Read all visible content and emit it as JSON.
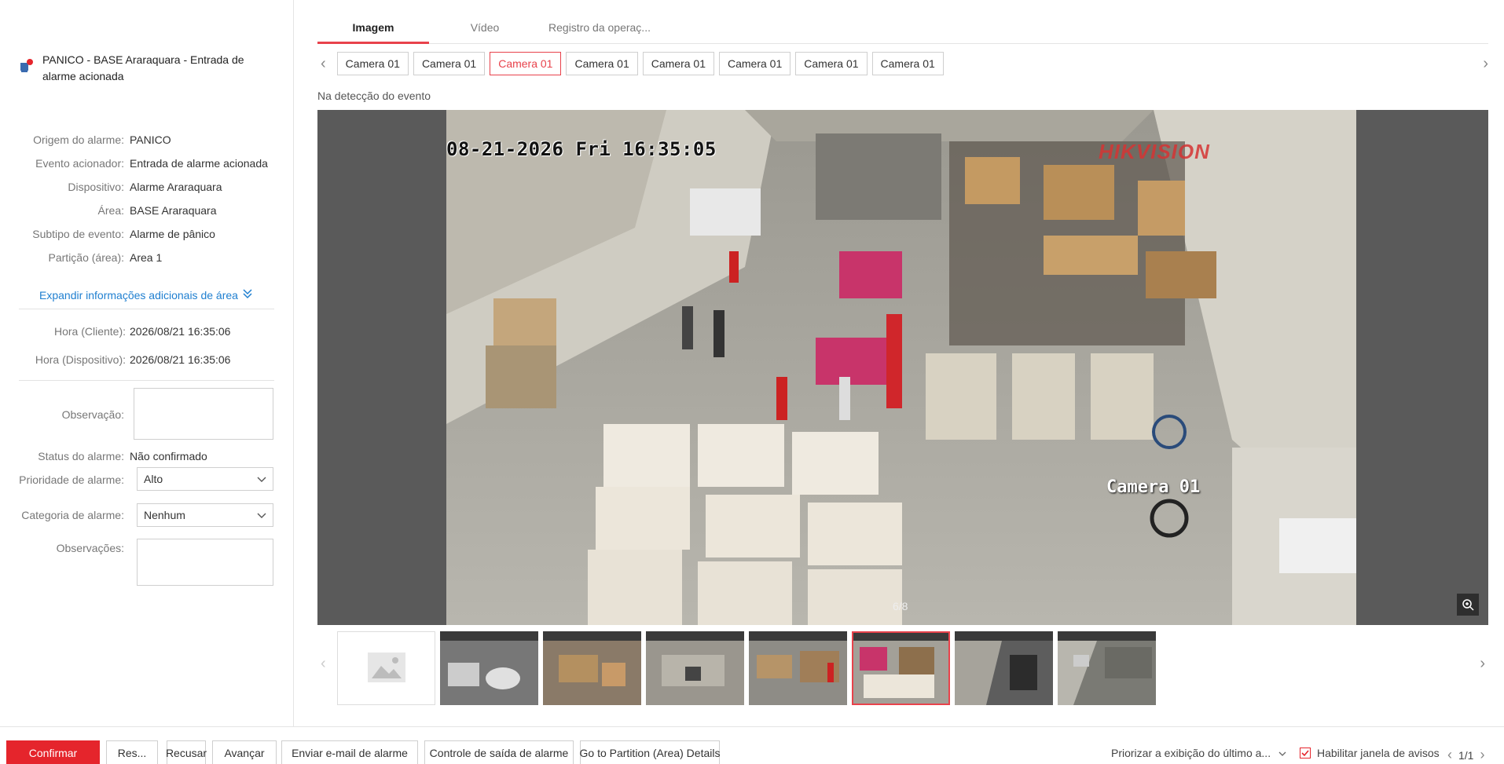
{
  "alarm": {
    "title": "PANICO - BASE Araraquara - Entrada de alarme acionada"
  },
  "details": [
    {
      "label": "Origem do alarme:",
      "value": "PANICO"
    },
    {
      "label": "Evento acionador:",
      "value": "Entrada de alarme acionada"
    },
    {
      "label": "Dispositivo:",
      "value": "Alarme Araraquara"
    },
    {
      "label": "Área:",
      "value": "BASE Araraquara"
    },
    {
      "label": "Subtipo de evento:",
      "value": "Alarme de pânico"
    },
    {
      "label": "Partição (área):",
      "value": "Area 1"
    }
  ],
  "expand_link": "Expandir informações adicionais de área",
  "times": [
    {
      "label": "Hora (Cliente):",
      "value": "2026/08/21 16:35:06"
    },
    {
      "label": "Hora (Dispositivo):",
      "value": "2026/08/21 16:35:06"
    }
  ],
  "form": {
    "observacao_label": "Observação:",
    "status_label": "Status do alarme:",
    "status_value": "Não confirmado",
    "priority_label": "Prioridade de alarme:",
    "priority_value": "Alto",
    "category_label": "Categoria de alarme:",
    "category_value": "Nenhum",
    "observacoes_label": "Observações:"
  },
  "tabs": [
    {
      "label": "Imagem"
    },
    {
      "label": "Vídeo"
    },
    {
      "label": "Registro da operaç..."
    }
  ],
  "cameras": [
    "Camera 01",
    "Camera 01",
    "Camera 01",
    "Camera 01",
    "Camera 01",
    "Camera 01",
    "Camera 01",
    "Camera 01"
  ],
  "caption": "Na detecção do evento",
  "osd": {
    "timestamp": "08-21-2026 Fri 16:35:05",
    "brand": "HIKVISION",
    "camera_name": "Camera 01"
  },
  "counter": "6/8",
  "bottom": {
    "confirm": "Confirmar",
    "res": "Res...",
    "refuse": "Recusar",
    "advance": "Avançar",
    "email": "Enviar e-mail de alarme",
    "output": "Controle de saída de alarme",
    "partition": "Go to Partition (Area) Details",
    "prioritize": "Priorizar a exibição do último a...",
    "enable_popup": "Habilitar janela de avisos",
    "pager": "1/1"
  },
  "colors": {
    "accent": "#e5252c",
    "link": "#1f7fd0"
  }
}
